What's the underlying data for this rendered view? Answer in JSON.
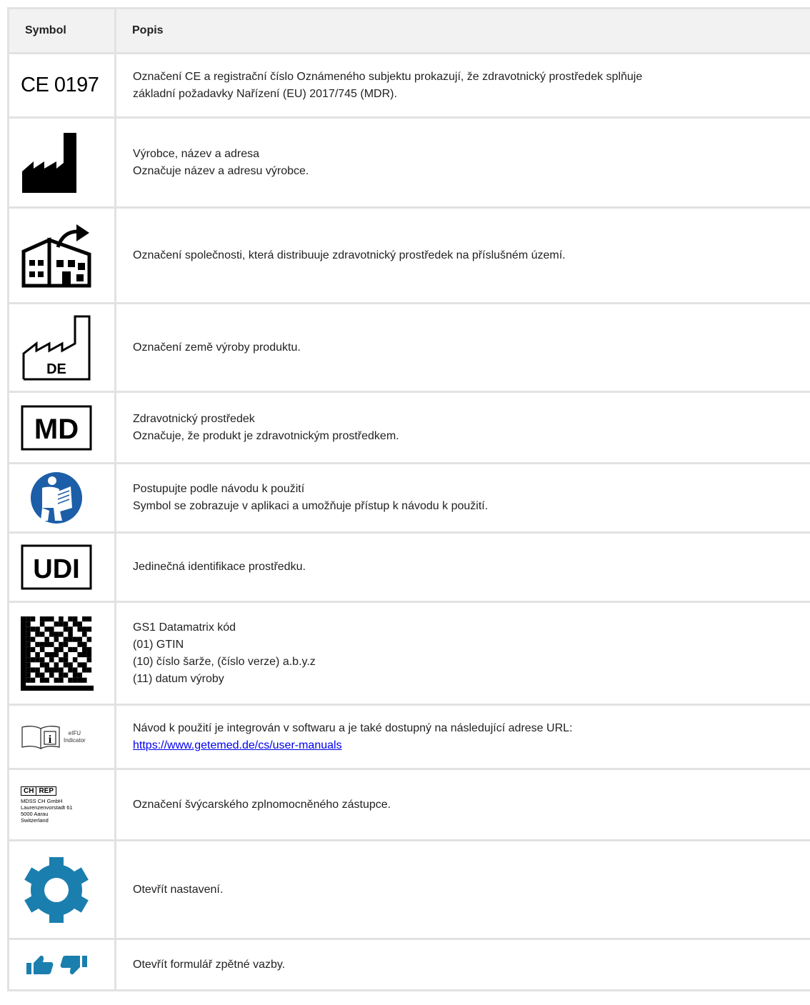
{
  "header": {
    "symbol": "Symbol",
    "description": "Popis"
  },
  "symbols": {
    "ce": {
      "mark": "CE 0197"
    },
    "dm_pattern": [
      "11011101011011",
      "10010011101100",
      "11101100110111",
      "10110111010010",
      "11001010111101",
      "10111101100110",
      "11010011011011",
      "10101110100111",
      "11110101101001",
      "10011010110110",
      "11101111011011",
      "10110101101100",
      "11011011011110"
    ],
    "eifu_label": [
      "eIFU",
      "Indicator"
    ],
    "ch_rep": {
      "tags": [
        "CH",
        "REP"
      ],
      "lines": [
        "MDSS CH GmbH",
        "Laurenzenvorstadt 61",
        "5000 Aarau",
        "Switzerland"
      ]
    },
    "md_label": "MD",
    "udi_label": "UDI",
    "de_label": "DE"
  },
  "rows": [
    {
      "symbol": "ce-mark-icon",
      "lines": [
        "Označení CE a registrační číslo Oznámeného subjektu prokazují, že zdravotnický prostředek splňuje",
        "základní požadavky Nařízení (EU) 2017/745 (MDR)."
      ]
    },
    {
      "symbol": "manufacturer-icon",
      "lines": [
        "Výrobce, název a adresa",
        "Označuje název a adresu výrobce."
      ]
    },
    {
      "symbol": "distributor-icon",
      "lines": [
        "Označení společnosti, která distribuuje zdravotnický prostředek na příslušném území."
      ]
    },
    {
      "symbol": "country-of-manufacture-icon",
      "lines": [
        "Označení země výroby produktu."
      ]
    },
    {
      "symbol": "medical-device-icon",
      "lines": [
        "Zdravotnický prostředek",
        "Označuje, že produkt je zdravotnickým prostředkem."
      ]
    },
    {
      "symbol": "read-instructions-icon",
      "lines": [
        "Postupujte podle návodu k použití",
        "Symbol se zobrazuje v aplikaci a umožňuje přístup k návodu k použití."
      ]
    },
    {
      "symbol": "udi-icon",
      "lines": [
        "Jedinečná identifikace prostředku."
      ]
    },
    {
      "symbol": "datamatrix-icon",
      "lines": [
        "GS1 Datamatrix kód",
        "(01) GTIN",
        "(10) číslo šarže, (číslo verze) a.b.y.z",
        "(11) datum výroby"
      ]
    },
    {
      "symbol": "eifu-icon",
      "lines": [
        "Návod k použití je integrován v softwaru a je také dostupný na následující adrese URL:"
      ],
      "link": "https://www.getemed.de/cs/user-manuals"
    },
    {
      "symbol": "ch-rep-icon",
      "lines": [
        "Označení švýcarského zplnomocněného zástupce."
      ]
    },
    {
      "symbol": "gear-icon",
      "lines": [
        "Otevřít nastavení."
      ]
    },
    {
      "symbol": "thumbs-feedback-icon",
      "lines": [
        "Otevřít formulář zpětné vazby."
      ]
    }
  ],
  "colors": {
    "header_bg": "#f2f2f2",
    "border": "#e2e2e2",
    "accent_blue": "#1a7fae",
    "mandatory_blue": "#1d5ea8",
    "link": "#0000ee"
  }
}
